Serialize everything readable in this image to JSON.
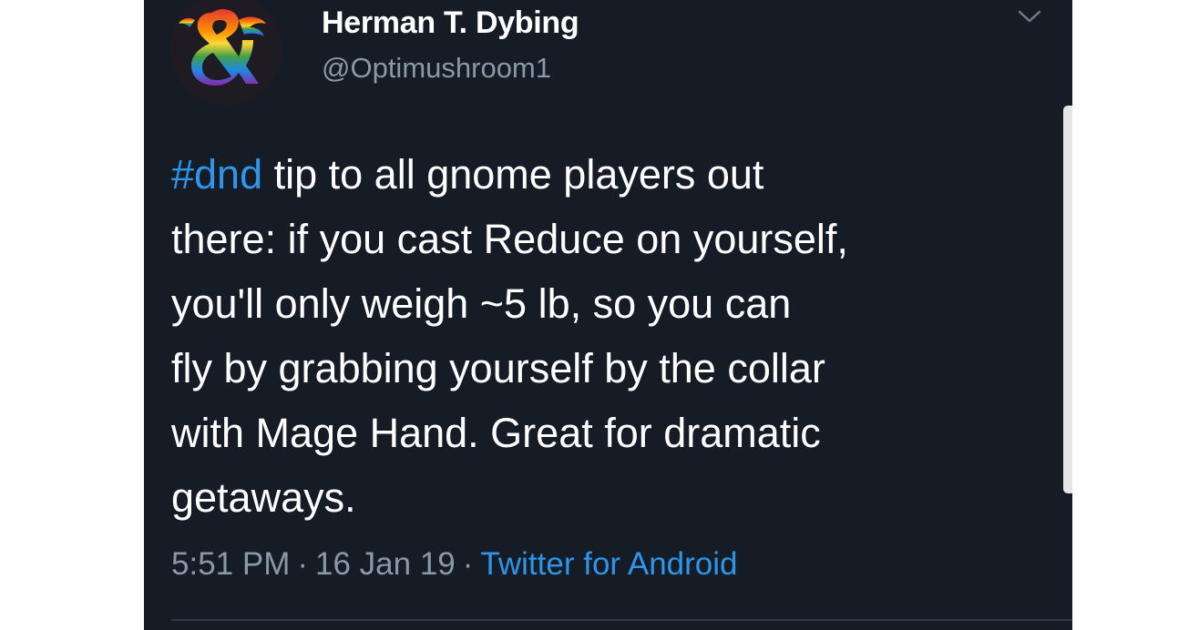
{
  "tweet": {
    "author": {
      "display_name": "Herman T. Dybing",
      "handle": "@Optimushroom1",
      "avatar_icon": "rainbow-ampersand-dragon-logo"
    },
    "text_lines": [
      {
        "hashtag": "#dnd",
        "rest": " tip to all gnome players out"
      },
      {
        "text": "there: if you cast Reduce on yourself,"
      },
      {
        "text": "you'll only weigh ~5 lb, so you can"
      },
      {
        "text": "fly by grabbing yourself by the collar"
      },
      {
        "text": "with Mage Hand. Great for dramatic"
      },
      {
        "text": "getaways."
      }
    ],
    "meta": {
      "time": "5:51 PM",
      "separator": "·",
      "date": "16 Jan 19",
      "source": "Twitter for Android"
    },
    "menu_icon": "chevron-down-icon"
  },
  "colors": {
    "background": "#151c26",
    "text": "#ffffff",
    "secondary_text": "#8a98a7",
    "link": "#2f95e8"
  }
}
